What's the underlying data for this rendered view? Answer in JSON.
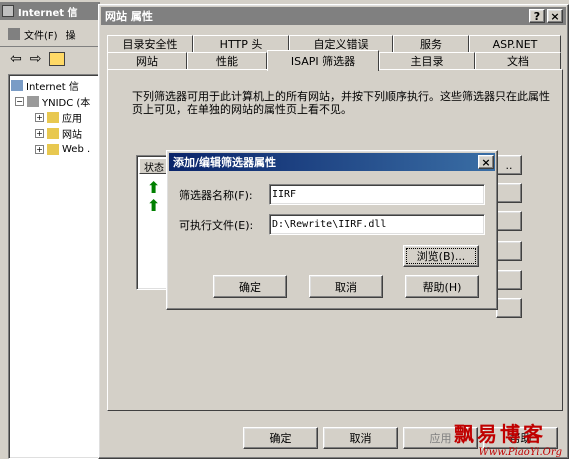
{
  "mmc": {
    "title": "Internet 信",
    "menu_file": "文件(F)",
    "menu_more": "操",
    "tree": [
      {
        "label": "Internet 信",
        "kind": "root"
      },
      {
        "label": "YNIDC (本",
        "kind": "server"
      },
      {
        "label": "应用",
        "kind": "folder"
      },
      {
        "label": "网站",
        "kind": "folder"
      },
      {
        "label": "Web .",
        "kind": "folder"
      }
    ]
  },
  "props": {
    "title": "网站 属性",
    "help_btn": "?",
    "close_btn": "×",
    "tabs_back": [
      "目录安全性",
      "HTTP 头",
      "自定义错误",
      "服务",
      "ASP.NET"
    ],
    "tabs_front": [
      "网站",
      "性能",
      "ISAPI 筛选器",
      "主目录",
      "文档"
    ],
    "description": "下列筛选器可用于此计算机上的所有网站，并按下列顺序执行。这些筛选器只在此属性页上可见，在单独的网站的属性页上看不见。",
    "list_header_status": "状态",
    "side_btn_1": "..",
    "ok": "确定",
    "cancel": "取消",
    "apply": "应用",
    "help": "帮助"
  },
  "dialog": {
    "title": "添加/编辑筛选器属性",
    "close": "×",
    "name_label": "筛选器名称(F):",
    "name_value": "IIRF",
    "exe_label": "可执行文件(E):",
    "exe_value": "D:\\Rewrite\\IIRF.dll",
    "browse": "浏览(B)...",
    "ok": "确定",
    "cancel": "取消",
    "help": "帮助(H)"
  },
  "watermark": {
    "text": "飘易博客",
    "url": "Www.PiaoYi.Org"
  },
  "colors": {
    "title_active": "#0a246a",
    "title_inactive": "#808080",
    "arrow_green": "#008000",
    "watermark_red": "#c00000"
  }
}
